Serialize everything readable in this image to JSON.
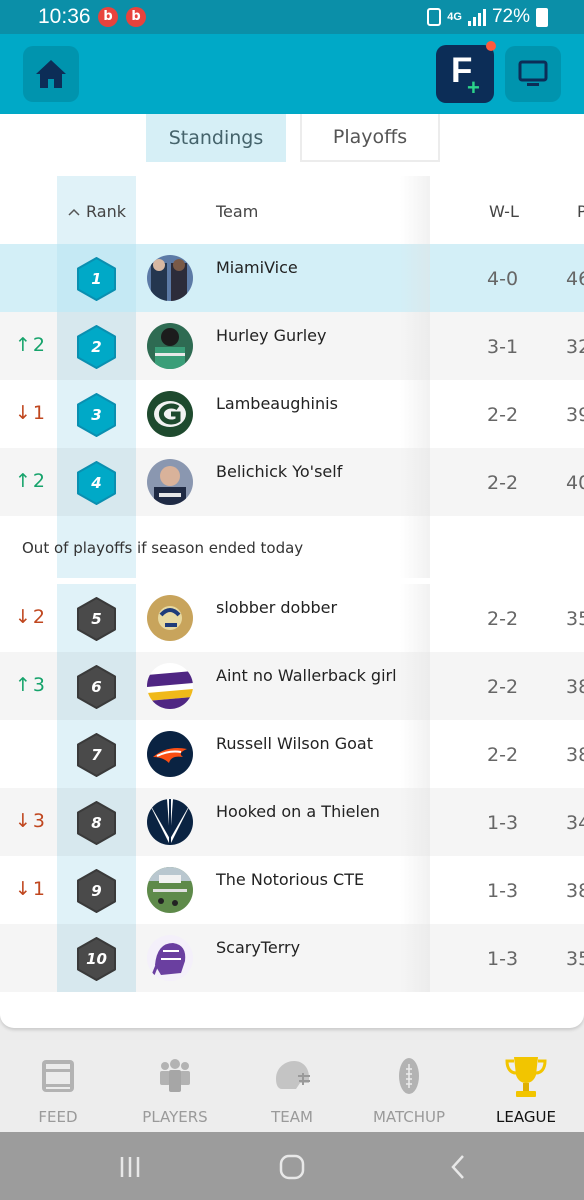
{
  "status_bar": {
    "time": "10:36",
    "notification_icons": [
      "b",
      "b"
    ],
    "network": "4G",
    "battery": "72%"
  },
  "app_bar": {
    "home_icon": "home-icon",
    "fantasy_icon": "fantasy-add-icon",
    "tv_icon": "tv-icon"
  },
  "tabs": {
    "standings": "Standings",
    "playoffs": "Playoffs"
  },
  "columns": {
    "rank": "Rank",
    "team": "Team",
    "wl": "W-L",
    "pf": "P"
  },
  "cutline": "Out of playoffs if season ended today",
  "rows": [
    {
      "change": "",
      "direction": "",
      "rank": "1",
      "team": "MiamiVice",
      "wl": "4-0",
      "pf": "46"
    },
    {
      "change": "2",
      "direction": "up",
      "rank": "2",
      "team": "Hurley Gurley",
      "wl": "3-1",
      "pf": "32"
    },
    {
      "change": "1",
      "direction": "down",
      "rank": "3",
      "team": "Lambeaughinis",
      "wl": "2-2",
      "pf": "39"
    },
    {
      "change": "2",
      "direction": "up",
      "rank": "4",
      "team": "Belichick Yo'self",
      "wl": "2-2",
      "pf": "40"
    },
    {
      "change": "2",
      "direction": "down",
      "rank": "5",
      "team": "slobber dobber",
      "wl": "2-2",
      "pf": "35"
    },
    {
      "change": "3",
      "direction": "up",
      "rank": "6",
      "team": "Aint no Wallerback girl",
      "wl": "2-2",
      "pf": "38"
    },
    {
      "change": "",
      "direction": "",
      "rank": "7",
      "team": "Russell Wilson Goat",
      "wl": "2-2",
      "pf": "38"
    },
    {
      "change": "3",
      "direction": "down",
      "rank": "8",
      "team": "Hooked on a Thielen",
      "wl": "1-3",
      "pf": "34"
    },
    {
      "change": "1",
      "direction": "down",
      "rank": "9",
      "team": "The Notorious CTE",
      "wl": "1-3",
      "pf": "38"
    },
    {
      "change": "",
      "direction": "",
      "rank": "10",
      "team": "ScaryTerry",
      "wl": "1-3",
      "pf": "35"
    }
  ],
  "bottom_nav": {
    "feed": "FEED",
    "players": "PLAYERS",
    "team": "TEAM",
    "matchup": "MATCHUP",
    "league": "LEAGUE",
    "active": "league"
  },
  "colors": {
    "accent": "#00a9c7",
    "playoff_rank": "#00a9c7",
    "out_rank": "#4a4a4a",
    "up": "#16a36b",
    "down": "#c0471f"
  }
}
